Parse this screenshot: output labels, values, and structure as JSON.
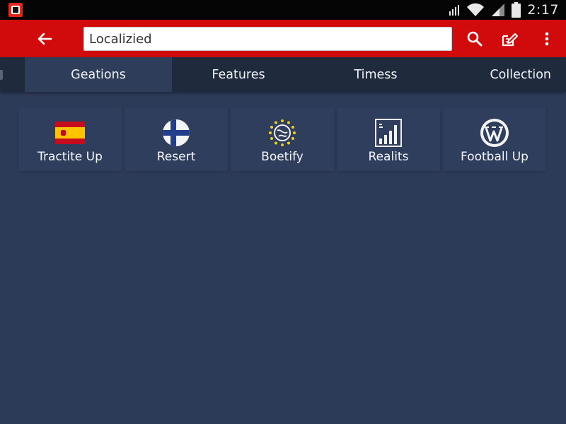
{
  "status_bar": {
    "time": "2:17",
    "icons": [
      "app-notification-icon",
      "signal-icon",
      "wifi-icon",
      "cell-signal-icon",
      "battery-icon"
    ]
  },
  "toolbar": {
    "search_value": "Localizied",
    "back_icon": "back-arrow-icon",
    "search_icon": "search-icon",
    "edit_icon": "edit-icon",
    "more_icon": "more-vert-icon",
    "color": "#d10b0b"
  },
  "tabs": [
    {
      "label": "Geations",
      "active": true
    },
    {
      "label": "Features",
      "active": false
    },
    {
      "label": "Timess",
      "active": false
    },
    {
      "label": "Collection",
      "active": false
    }
  ],
  "grid": {
    "items": [
      {
        "label": "Tractite Up",
        "icon": "spain-flag-icon"
      },
      {
        "label": "Resert",
        "icon": "finland-flag-icon"
      },
      {
        "label": "Boetify",
        "icon": "globe-stars-icon"
      },
      {
        "label": "Realits",
        "icon": "bar-chart-icon"
      },
      {
        "label": "Football Up",
        "icon": "wordpress-icon"
      }
    ]
  },
  "colors": {
    "background": "#2c3b58",
    "tab_bar": "#1f2a3d",
    "tab_active": "#2e3d59",
    "toolbar": "#d10b0b"
  }
}
